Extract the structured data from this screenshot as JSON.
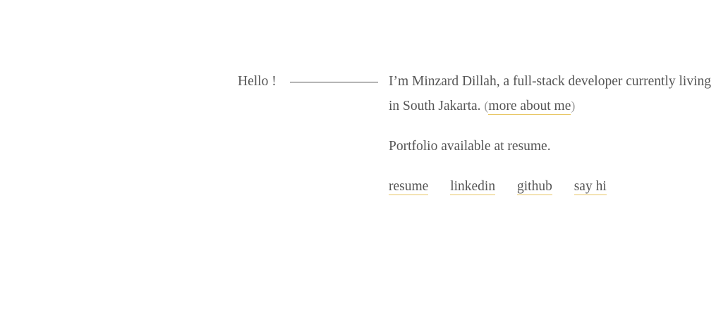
{
  "colors": {
    "text": "#555555",
    "underline_accent": "#e8c766",
    "paren": "#9a9a9a",
    "background": "#ffffff"
  },
  "greeting": "Hello !",
  "intro": {
    "text": "I’m Minzard Dillah, a full-stack developer currently living in South Jakarta.",
    "paren_open": "(",
    "more_link": "more about me",
    "paren_close": ")"
  },
  "portfolio_text": "Portfolio available at resume.",
  "links": [
    {
      "label": "resume"
    },
    {
      "label": "linkedin"
    },
    {
      "label": "github"
    },
    {
      "label": "say hi"
    }
  ]
}
